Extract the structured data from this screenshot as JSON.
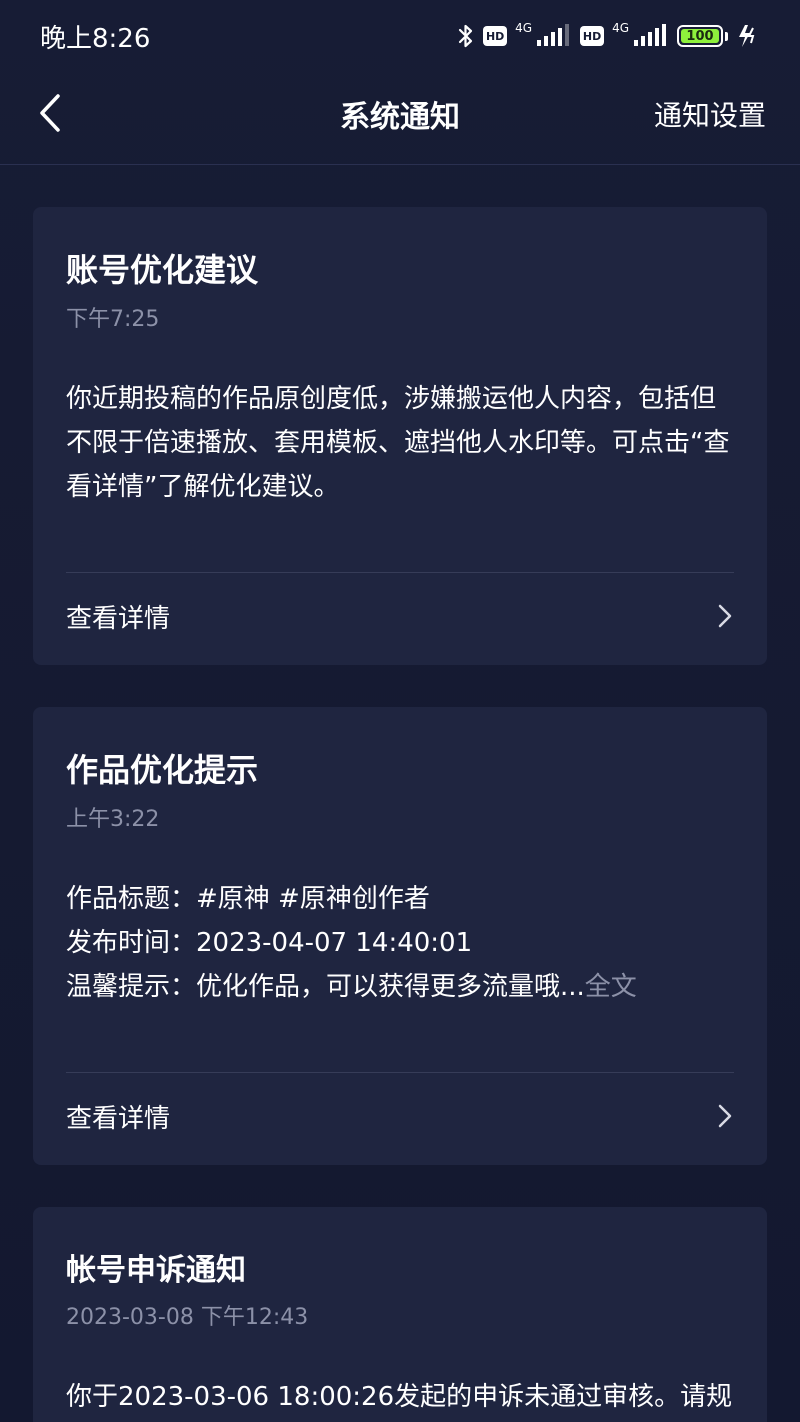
{
  "status_bar": {
    "time": "晚上8:26",
    "hd1": "HD",
    "net1": "4G",
    "hd2": "HD",
    "net2": "4G",
    "battery": "100",
    "battery_level": 1.0,
    "battery_color": "#8ef03c"
  },
  "nav": {
    "title": "系统通知",
    "settings_label": "通知设置"
  },
  "cards": [
    {
      "title": "账号优化建议",
      "time": "下午7:25",
      "body_lines": [
        "你近期投稿的作品原创度低，涉嫌搬运他人内容，包括但",
        "不限于倍速播放、套用模板、遮挡他人水印等。可点击“查",
        "看详情”了解优化建议。"
      ],
      "link": "查看详情"
    },
    {
      "title": "作品优化提示",
      "time": "上午3:22",
      "body_lines": [
        "作品标题：#原神 #原神创作者",
        "发布时间：2023-04-07 14:40:01",
        "温馨提示：优化作品，可以获得更多流量哦..."
      ],
      "full_text": "全文",
      "link": "查看详情"
    },
    {
      "title": "帐号申诉通知",
      "time": "2023-03-08 下午12:43",
      "body_lines": [
        "你于2023-03-06 18:00:26发起的申诉未通过审核。请规"
      ]
    }
  ],
  "colors": {
    "background": "#161b33",
    "card": "#1f2540",
    "muted_text": "#8c91a8"
  }
}
